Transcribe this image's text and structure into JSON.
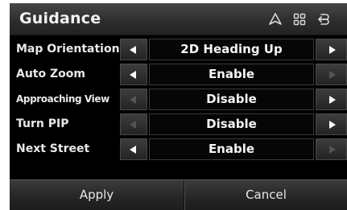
{
  "header": {
    "title": "Guidance",
    "icons": [
      "navigation-icon",
      "menu-grid-icon",
      "back-icon"
    ]
  },
  "settings": [
    {
      "label": "Map Orientation",
      "value": "2D Heading Up",
      "left_enabled": true,
      "right_enabled": true
    },
    {
      "label": "Auto Zoom",
      "value": "Enable",
      "left_enabled": true,
      "right_enabled": false
    },
    {
      "label": "Approaching View",
      "value": "Disable",
      "left_enabled": false,
      "right_enabled": true
    },
    {
      "label": "Turn PIP",
      "value": "Disable",
      "left_enabled": false,
      "right_enabled": true
    },
    {
      "label": "Next Street",
      "value": "Enable",
      "left_enabled": true,
      "right_enabled": false
    }
  ],
  "footer": {
    "apply_label": "Apply",
    "cancel_label": "Cancel"
  },
  "colors": {
    "background": "#000000",
    "text": "#f4f4f4",
    "disabled_arrow": "#555555"
  }
}
